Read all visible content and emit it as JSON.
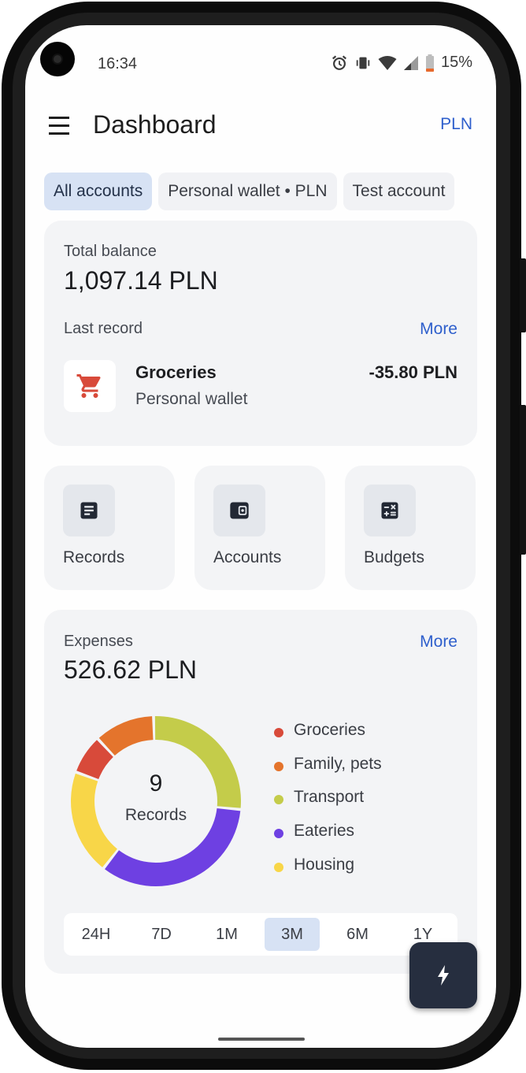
{
  "status_bar": {
    "time": "16:34",
    "battery": "15%"
  },
  "appbar": {
    "title": "Dashboard",
    "currency": "PLN"
  },
  "account_chips": [
    {
      "label": "All accounts",
      "selected": true
    },
    {
      "label": "Personal wallet • PLN",
      "selected": false
    },
    {
      "label": "Test account",
      "selected": false
    }
  ],
  "balance": {
    "label": "Total balance",
    "amount": "1,097.14 PLN",
    "last_record_label": "Last record",
    "more_label": "More",
    "last_record": {
      "category": "Groceries",
      "account": "Personal wallet",
      "amount": "-35.80 PLN",
      "icon": "cart-icon",
      "icon_color": "#d84a3a"
    }
  },
  "shortcuts": [
    {
      "label": "Records",
      "icon": "records-icon"
    },
    {
      "label": "Accounts",
      "icon": "wallet-icon"
    },
    {
      "label": "Budgets",
      "icon": "calculator-icon"
    }
  ],
  "expenses": {
    "label": "Expenses",
    "amount": "526.62 PLN",
    "more_label": "More",
    "records_count": "9",
    "records_label": "Records",
    "chart_data": {
      "type": "pie",
      "series": [
        {
          "name": "Groceries",
          "value": 7.5,
          "color": "#d84a3a"
        },
        {
          "name": "Family, pets",
          "value": 11.5,
          "color": "#e4742c"
        },
        {
          "name": "Transport",
          "value": 27,
          "color": "#c4cc4a"
        },
        {
          "name": "Eateries",
          "value": 34,
          "color": "#6e40e2"
        },
        {
          "name": "Housing",
          "value": 20,
          "color": "#f8d648"
        }
      ]
    },
    "periods": [
      "24H",
      "7D",
      "1M",
      "3M",
      "6M",
      "1Y"
    ],
    "selected_period": "3M"
  },
  "fab": {
    "icon": "bolt-icon"
  }
}
